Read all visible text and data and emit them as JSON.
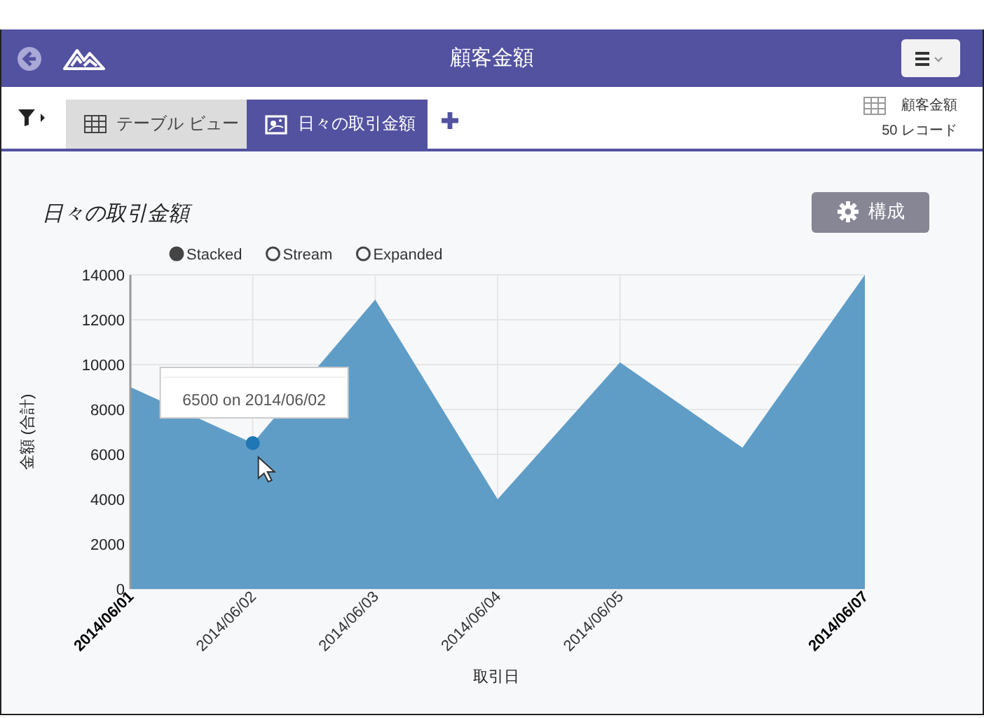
{
  "header": {
    "title": "顧客金額"
  },
  "tabs": [
    {
      "label": "テーブル ビュー",
      "kind": "table",
      "selected": false
    },
    {
      "label": "日々の取引金額",
      "kind": "chart",
      "selected": true
    }
  ],
  "source": {
    "name": "顧客金額",
    "count": "50 レコード"
  },
  "panel": {
    "title": "日々の取引金額",
    "config_button": "構成",
    "legend": [
      {
        "label": "Stacked",
        "selected": true
      },
      {
        "label": "Stream",
        "selected": false
      },
      {
        "label": "Expanded",
        "selected": false
      }
    ],
    "chart_data": {
      "type": "area",
      "xlabel": "取引日",
      "ylabel": "金額 (合計)",
      "categories": [
        "2014/06/01",
        "2014/06/02",
        "2014/06/03",
        "2014/06/04",
        "2014/06/05",
        null,
        "2014/06/07"
      ],
      "series": [
        {
          "color": "#5f9dc7",
          "values": [
            9000,
            6500,
            12900,
            4000,
            10100,
            6300,
            14000
          ]
        }
      ],
      "ylim": [
        0,
        14000
      ],
      "grid": true,
      "yticks": [
        0,
        2000,
        4000,
        6000,
        8000,
        10000,
        12000,
        14000
      ],
      "annotations": [
        {
          "x": "2014/06/02",
          "y": 6500,
          "text": "6500 on 2014/06/02"
        }
      ]
    }
  }
}
